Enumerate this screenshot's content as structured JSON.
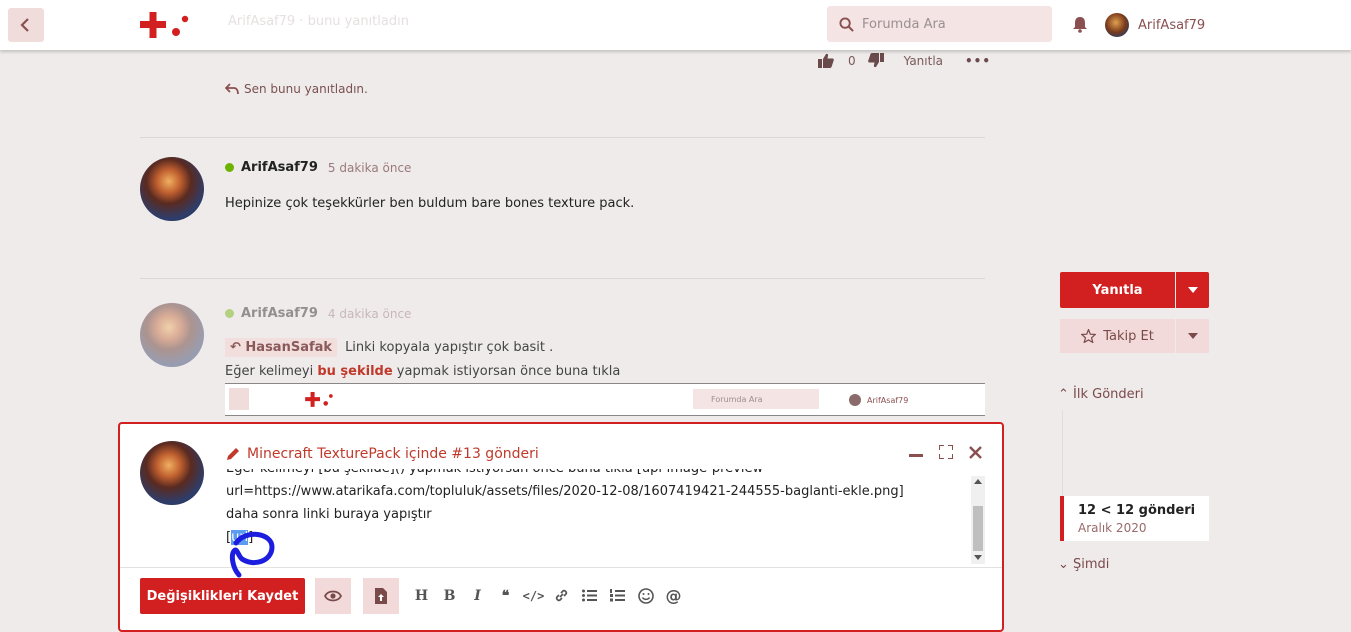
{
  "header": {
    "ghost_text": "ArifAsaf79 · bunu yanıtladın",
    "search_placeholder": "Forumda Ara",
    "username": "ArifAsaf79"
  },
  "prev_post": {
    "like_count": "0",
    "reply_label": "Yanıtla",
    "replied_note": "Sen bunu yanıtladın."
  },
  "post1": {
    "username": "ArifAsaf79",
    "time": "5 dakika önce",
    "text": "Hepinize çok teşekkürler ben buldum bare bones texture pack."
  },
  "post2": {
    "username": "ArifAsaf79",
    "time": "4 dakika önce",
    "quote_user": "HasanSafak",
    "quote_text": "Linki kopyala yapıştır çok basit .",
    "line_pre": "Eğer kelimeyi ",
    "line_bold": "bu şekilde",
    "line_post": " yapmak istiyorsan önce buna tıkla",
    "mini_search": "Forumda Ara",
    "mini_user": "ArifAsaf79"
  },
  "editor": {
    "title": "Minecraft TexturePack içinde #13 gönderi",
    "line1": "Eğer kelimeyi [bu şekilde]() yapmak istiyorsan önce buna tıkla [upl-image-preview",
    "line2": "url=https://www.atarikafa.com/topluluk/assets/files/2020-12-08/1607419421-244555-baglanti-ekle.png]",
    "line3": "daha sonra linki buraya yapıştır",
    "line4_pre": "[",
    "line4_sel": "url",
    "line4_post": "]",
    "save_label": "Değişiklikleri Kaydet"
  },
  "sidebar": {
    "reply_label": "Yanıtla",
    "follow_label": "Takip Et",
    "first_post": "İlk Gönderi",
    "current_count": "12 < 12 gönderi",
    "current_date": "Aralık 2020",
    "now_label": "Şimdi"
  },
  "colors": {
    "brand_red": "#d22020",
    "online_green": "#6bb300"
  }
}
